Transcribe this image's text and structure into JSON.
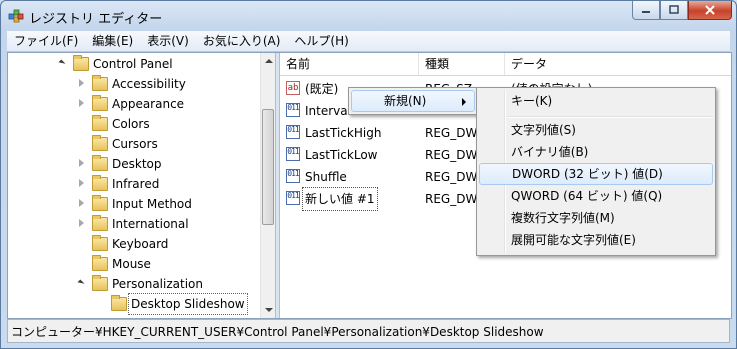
{
  "window": {
    "title": "レジストリ エディター"
  },
  "menubar": {
    "items": [
      "ファイル(F)",
      "編集(E)",
      "表示(V)",
      "お気に入り(A)",
      "ヘルプ(H)"
    ]
  },
  "tree": {
    "root": "Control Panel",
    "children": [
      "Accessibility",
      "Appearance",
      "Colors",
      "Cursors",
      "Desktop",
      "Infrared",
      "Input Method",
      "International",
      "Keyboard",
      "Mouse",
      "Personalization"
    ],
    "selected": "Desktop Slideshow"
  },
  "list": {
    "headers": {
      "name": "名前",
      "type": "種類",
      "data": "データ"
    },
    "rows": [
      {
        "icon": "ab",
        "name": "(既定)",
        "type": "REG_SZ",
        "data": "(値の設定なし)"
      },
      {
        "icon": "011",
        "name": "Interval",
        "type": "",
        "data": ""
      },
      {
        "icon": "011",
        "name": "LastTickHigh",
        "type": "REG_DW",
        "data": ""
      },
      {
        "icon": "011",
        "name": "LastTickLow",
        "type": "REG_DW",
        "data": ""
      },
      {
        "icon": "011",
        "name": "Shuffle",
        "type": "REG_DW",
        "data": ""
      },
      {
        "icon": "011",
        "name": "新しい値 #1",
        "type": "REG_DW",
        "data": ""
      }
    ]
  },
  "context_menu": {
    "new_label": "新規(N)"
  },
  "submenu": {
    "items": [
      "キー(K)",
      "文字列値(S)",
      "バイナリ値(B)",
      "DWORD (32 ビット) 値(D)",
      "QWORD (64 ビット) 値(Q)",
      "複数行文字列値(M)",
      "展開可能な文字列値(E)"
    ],
    "highlighted": "DWORD (32 ビット) 値(D)"
  },
  "statusbar": {
    "path": "コンピューター¥HKEY_CURRENT_USER¥Control Panel¥Personalization¥Desktop Slideshow"
  },
  "colors": {
    "titlebar": "#c4d6ec",
    "close_button": "#c7422a",
    "highlight": "#dcebfc",
    "folder": "#e7c25e"
  }
}
